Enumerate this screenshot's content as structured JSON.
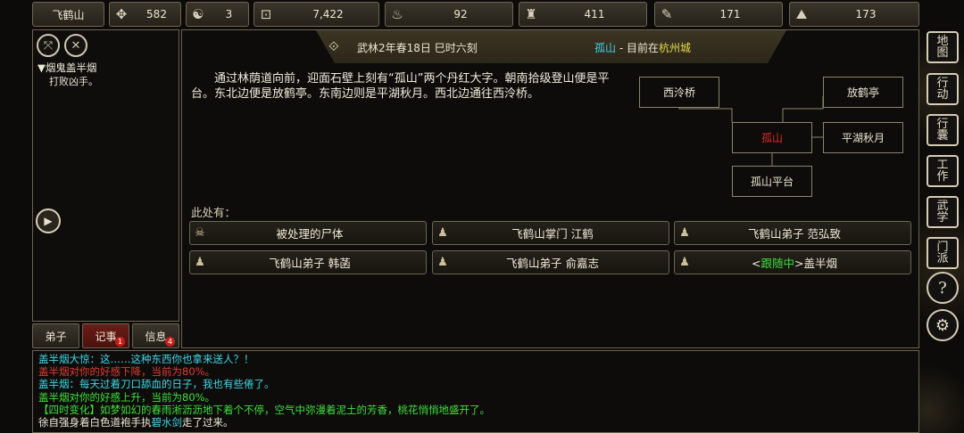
{
  "topbar": {
    "name": "飞鹤山",
    "stats": [
      {
        "icon": "beast-icon",
        "glyph": "✥",
        "value": "582"
      },
      {
        "icon": "yinyang-icon",
        "glyph": "☯",
        "value": "3"
      },
      {
        "icon": "coin-icon",
        "glyph": "⊡",
        "value": "7,422"
      },
      {
        "icon": "food-icon",
        "glyph": "♨",
        "value": "92"
      },
      {
        "icon": "gourd-icon",
        "glyph": "♜",
        "value": "411"
      },
      {
        "icon": "scroll-icon",
        "glyph": "✎",
        "value": "171"
      },
      {
        "icon": "ore-icon",
        "glyph": "⛰",
        "value": "173"
      }
    ]
  },
  "left_panel": {
    "quest_title": "▼烟鬼盖半烟",
    "quest_desc": "打败凶手。",
    "tabs": [
      {
        "label": "弟子",
        "badge": ""
      },
      {
        "label": "记事",
        "badge": "1"
      },
      {
        "label": "信息",
        "badge": "4"
      }
    ]
  },
  "location": {
    "date": "武林2年春18日 巳时六刻",
    "place": "孤山",
    "separator": " - 目前在",
    "city": "杭州城"
  },
  "description": "通过林荫道向前，迎面石壁上刻有“孤山”两个丹红大字。朝南拾级登山便是平台。东北边便是放鹤亭。东南边则是平湖秋月。西北边通往西泠桥。",
  "map": {
    "northwest": "西泠桥",
    "northeast": "放鹤亭",
    "current": "孤山",
    "southeast": "平湖秋月",
    "south": "孤山平台"
  },
  "here_label": "此处有：",
  "entities": [
    {
      "icon": "skull",
      "label": "被处理的尸体"
    },
    {
      "icon": "person",
      "label": "飞鹤山掌门 江鹤"
    },
    {
      "icon": "person",
      "label": "飞鹤山弟子 范弘致"
    },
    {
      "icon": "person",
      "label": "飞鹤山弟子 韩菡"
    },
    {
      "icon": "person",
      "label": "飞鹤山弟子 俞嘉志"
    },
    {
      "icon": "person",
      "label_prefix": "<",
      "label_follow": "跟随中",
      "label_suffix": ">盖半烟"
    }
  ],
  "log": [
    {
      "color": "cyan",
      "text": "盖半烟大惊：这……这种东西你也拿来送人？！"
    },
    {
      "color": "red",
      "text": "盖半烟对你的好感下降，当前为80%。"
    },
    {
      "color": "cyan",
      "text": "盖半烟：每天过着刀口舔血的日子，我也有些倦了。"
    },
    {
      "color": "green",
      "text": "盖半烟对你的好感上升，当前为80%。"
    },
    {
      "color": "green",
      "text": "【四时变化】如梦如幻的春雨淅沥沥地下着个不停，空气中弥漫着泥土的芳香，桃花悄悄地盛开了。"
    },
    {
      "color": "white",
      "text_before": "徐自强身着白色道袍手执",
      "text_link": "碧水剑",
      "text_after": "走了过来。"
    }
  ],
  "right_menu": [
    {
      "label": "地图"
    },
    {
      "label": "行动"
    },
    {
      "label": "行囊"
    },
    {
      "label": "工作"
    },
    {
      "label": "武学"
    },
    {
      "label": "门派"
    },
    {
      "label": "?"
    },
    {
      "label": "⚙"
    }
  ]
}
